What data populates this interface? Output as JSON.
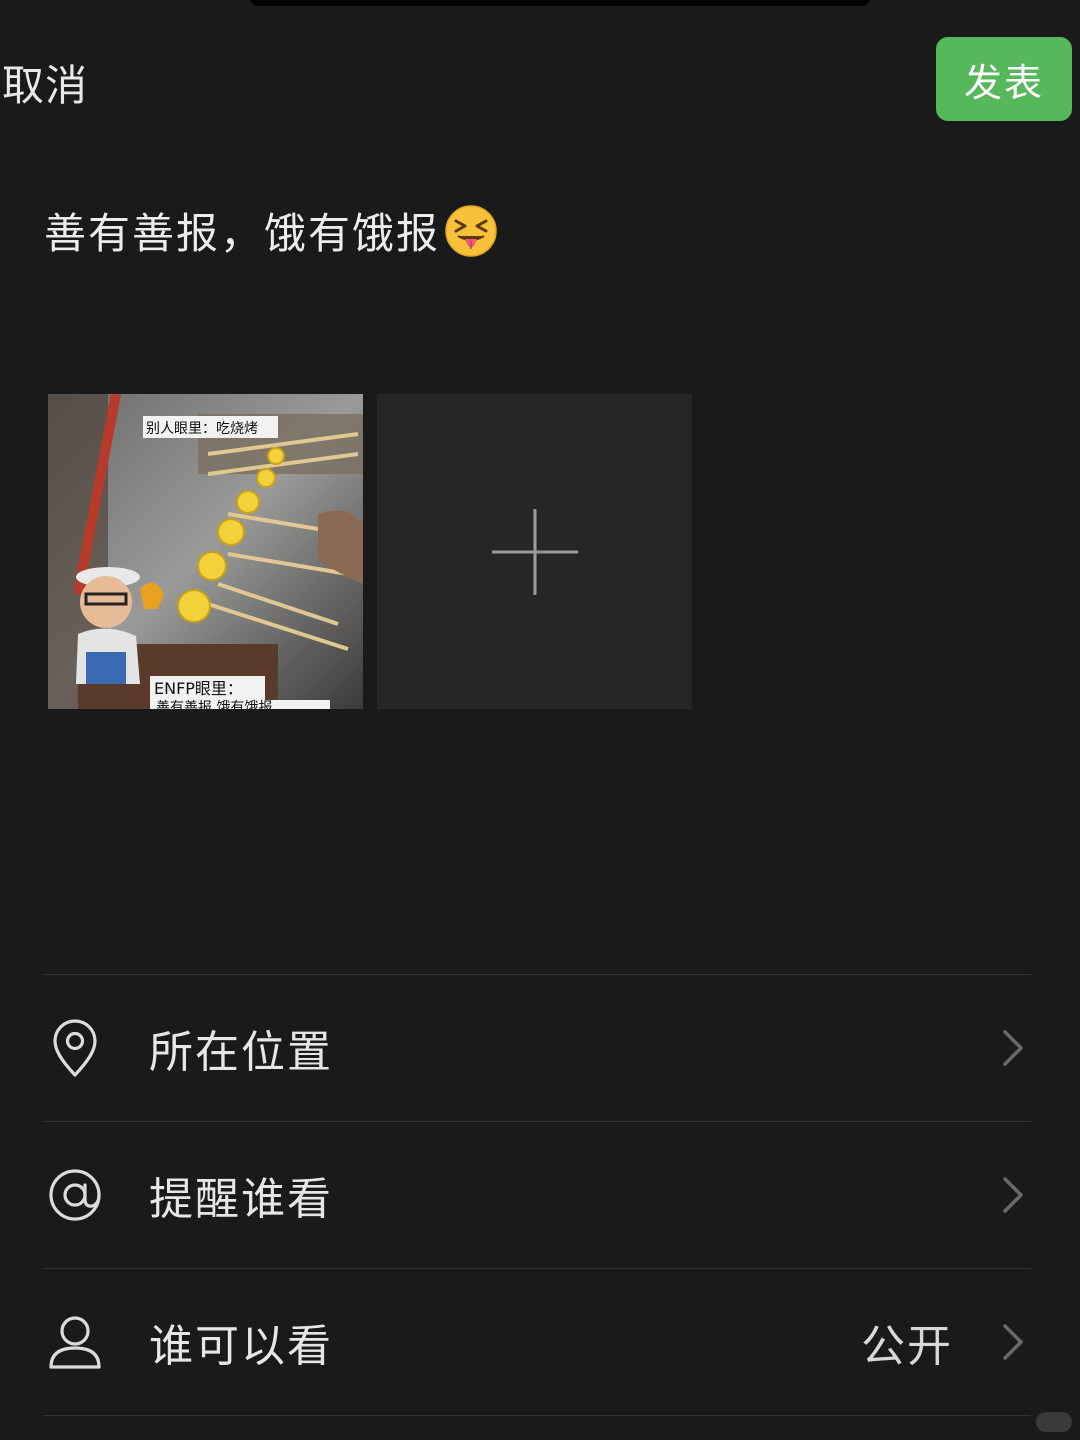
{
  "header": {
    "cancel_label": "取消",
    "publish_label": "发表",
    "publish_color": "#56b85b"
  },
  "post": {
    "text": "善有善报，饿有饿报",
    "emoji": "squinting-face-with-tongue"
  },
  "media": {
    "image": {
      "caption_top": "别人眼里：吃烧烤",
      "caption_bottom": "ENFP眼里：",
      "caption_bottom_cut": "善有善报 饿有饿报"
    },
    "add_icon": "plus-icon"
  },
  "options": [
    {
      "icon": "location-pin-icon",
      "label": "所在位置",
      "value": ""
    },
    {
      "icon": "at-sign-icon",
      "label": "提醒谁看",
      "value": ""
    },
    {
      "icon": "person-icon",
      "label": "谁可以看",
      "value": "公开"
    }
  ]
}
